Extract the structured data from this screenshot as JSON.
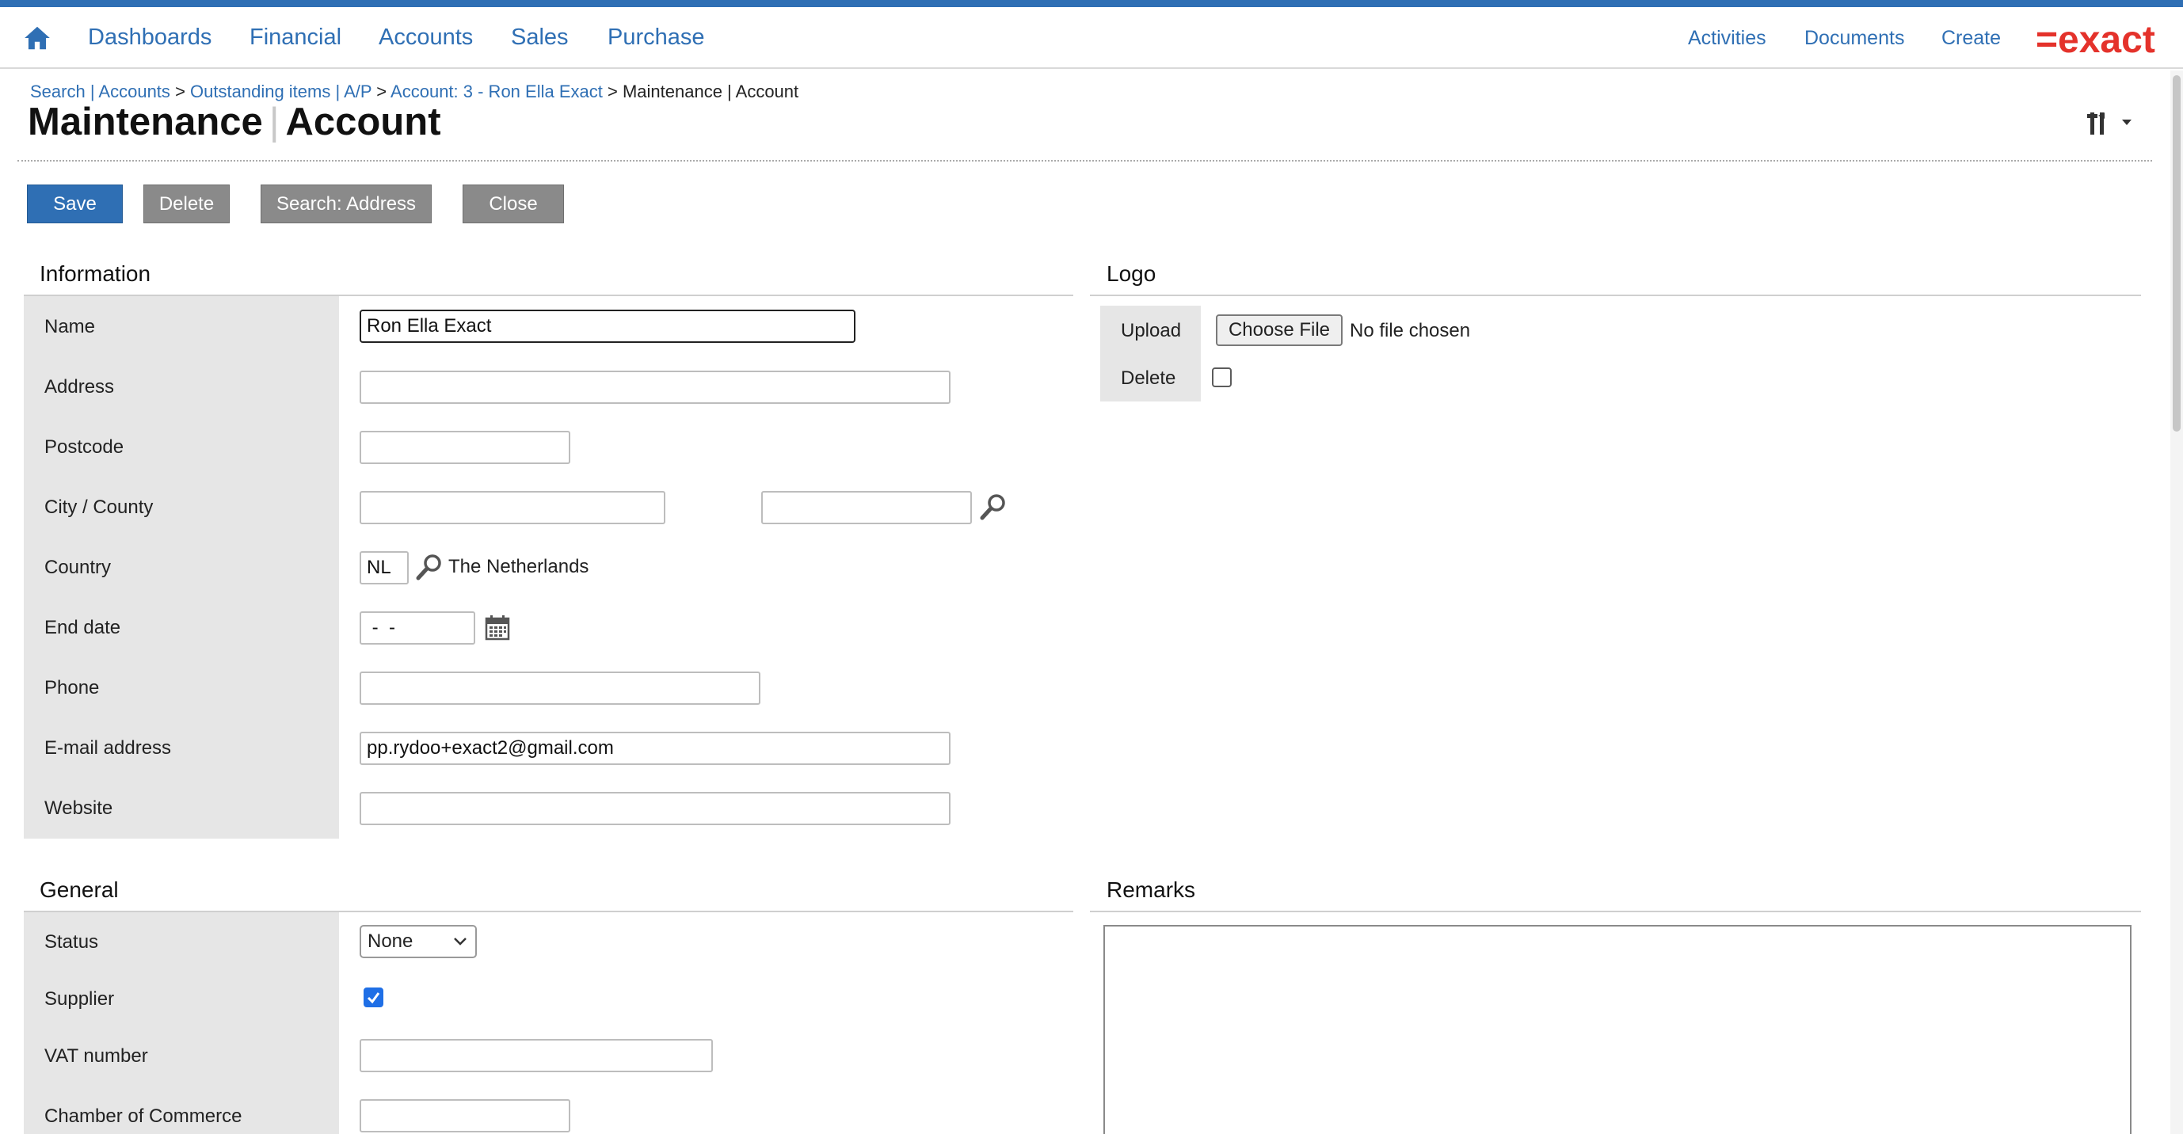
{
  "nav": {
    "items": [
      "Dashboards",
      "Financial",
      "Accounts",
      "Sales",
      "Purchase"
    ],
    "right_items": [
      "Activities",
      "Documents",
      "Create"
    ],
    "logo_text": "=exact",
    "accent_color": "#2f6fb4",
    "brand_color": "#e4322b"
  },
  "breadcrumb": {
    "items": [
      "Search | Accounts",
      "Outstanding items | A/P",
      "Account: 3 - Ron Ella Exact"
    ],
    "separator": ">",
    "current": "Maintenance | Account"
  },
  "page_title": {
    "part1": "Maintenance",
    "divider": "|",
    "part2": "Account"
  },
  "toolbar": {
    "save_label": "Save",
    "delete_label": "Delete",
    "search_address_label": "Search: Address",
    "close_label": "Close"
  },
  "information": {
    "title": "Information",
    "labels": {
      "name": "Name",
      "address": "Address",
      "postcode": "Postcode",
      "city_county": "City / County",
      "country": "Country",
      "end_date": "End date",
      "phone": "Phone",
      "email": "E-mail address",
      "website": "Website"
    },
    "values": {
      "name": "Ron Ella Exact",
      "address": "",
      "postcode": "",
      "city": "",
      "county": "",
      "country_code": "NL",
      "country_name": "The Netherlands",
      "end_date": " -  -",
      "phone": "",
      "email": "pp.rydoo+exact2@gmail.com",
      "website": ""
    }
  },
  "logo_section": {
    "title": "Logo",
    "upload_label": "Upload",
    "choose_file_label": "Choose File",
    "no_file_text": "No file chosen",
    "delete_label": "Delete",
    "delete_checked": false
  },
  "general": {
    "title": "General",
    "labels": {
      "status": "Status",
      "supplier": "Supplier",
      "vat_number": "VAT number",
      "chamber_of_commerce": "Chamber of Commerce"
    },
    "values": {
      "status": "None",
      "supplier_checked": true,
      "vat_number": "",
      "chamber_of_commerce": ""
    }
  },
  "remarks": {
    "title": "Remarks",
    "value": ""
  },
  "icons": {
    "home": "home-icon",
    "lookup": "magnifier-icon",
    "calendar": "calendar-icon",
    "tools": "tools-icon",
    "dropdown": "chevron-down-icon"
  }
}
